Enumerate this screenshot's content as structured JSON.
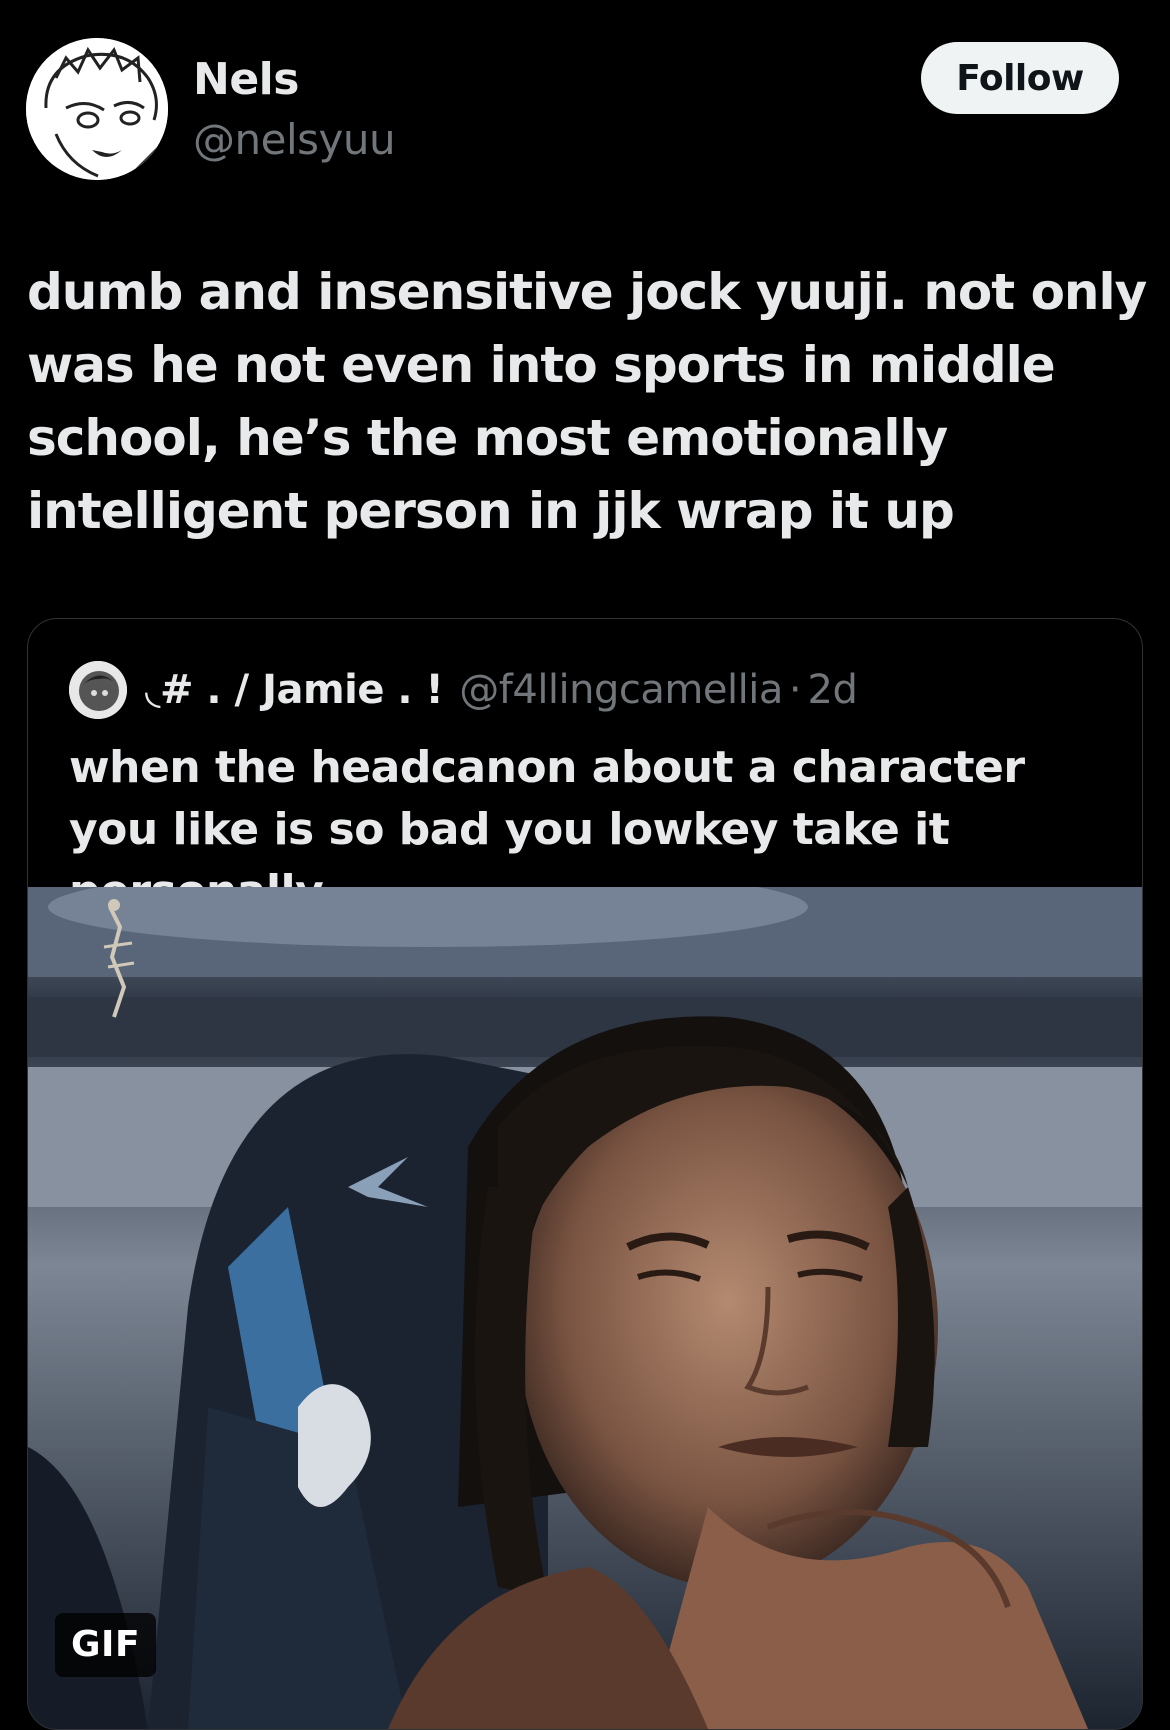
{
  "author": {
    "display_name": "Nels",
    "handle": "@nelsyuu",
    "follow_label": "Follow"
  },
  "tweet": {
    "text": "dumb and insensitive jock yuuji. not only was he not even into sports in middle school, he’s the most emotionally intelligent person in jjk wrap it up"
  },
  "quoted": {
    "display_name": "◟# . / Jamie . !",
    "handle": "@f4llingcamellia",
    "separator": "·",
    "time": "2d",
    "text": "when the headcanon about a character you like is so bad you lowkey take it personally",
    "media_badge": "GIF"
  },
  "colors": {
    "background": "#000000",
    "primary_text": "#e7e9ea",
    "secondary_text": "#71767b",
    "border": "#2f3336",
    "follow_bg": "#eff3f4"
  }
}
